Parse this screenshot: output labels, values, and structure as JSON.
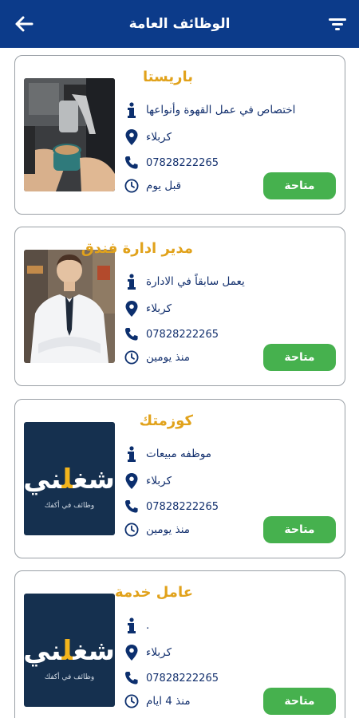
{
  "header": {
    "title": "الوظائف العامة",
    "back_icon": "arrow-left-icon",
    "filter_icon": "filter-icon"
  },
  "colors": {
    "header": "#0c3b8a",
    "title_accent": "#e1a21b",
    "badge": "#46b14e",
    "text": "#13306e"
  },
  "logo": {
    "word_before": "شغ",
    "word_highlight": "ل",
    "word_after": "ني",
    "subtitle": "وظائف في أكفك"
  },
  "jobs": [
    {
      "title": "باريستا",
      "description": "اختصاص  في عمل القهوة وأنواعها",
      "location": "كربلاء",
      "phone": "07828222265",
      "posted": "قبل يوم",
      "status": "متاحة",
      "image": "barista-photo"
    },
    {
      "title": "مدير ادارة فندق",
      "description": "يعمل سابقاً في الادارة",
      "location": "كربلاء",
      "phone": "07828222265",
      "posted": "منذ يومين",
      "status": "متاحة",
      "image": "manager-photo"
    },
    {
      "title": "كوزمتك",
      "description": "موظفه مبيعات",
      "location": "كربلاء",
      "phone": "07828222265",
      "posted": "منذ يومين",
      "status": "متاحة",
      "image": "brand-logo"
    },
    {
      "title": "عامل خدمة",
      "description": ".",
      "location": "كربلاء",
      "phone": "07828222265",
      "posted": "منذ 4 ايام",
      "status": "متاحة",
      "image": "brand-logo"
    }
  ]
}
